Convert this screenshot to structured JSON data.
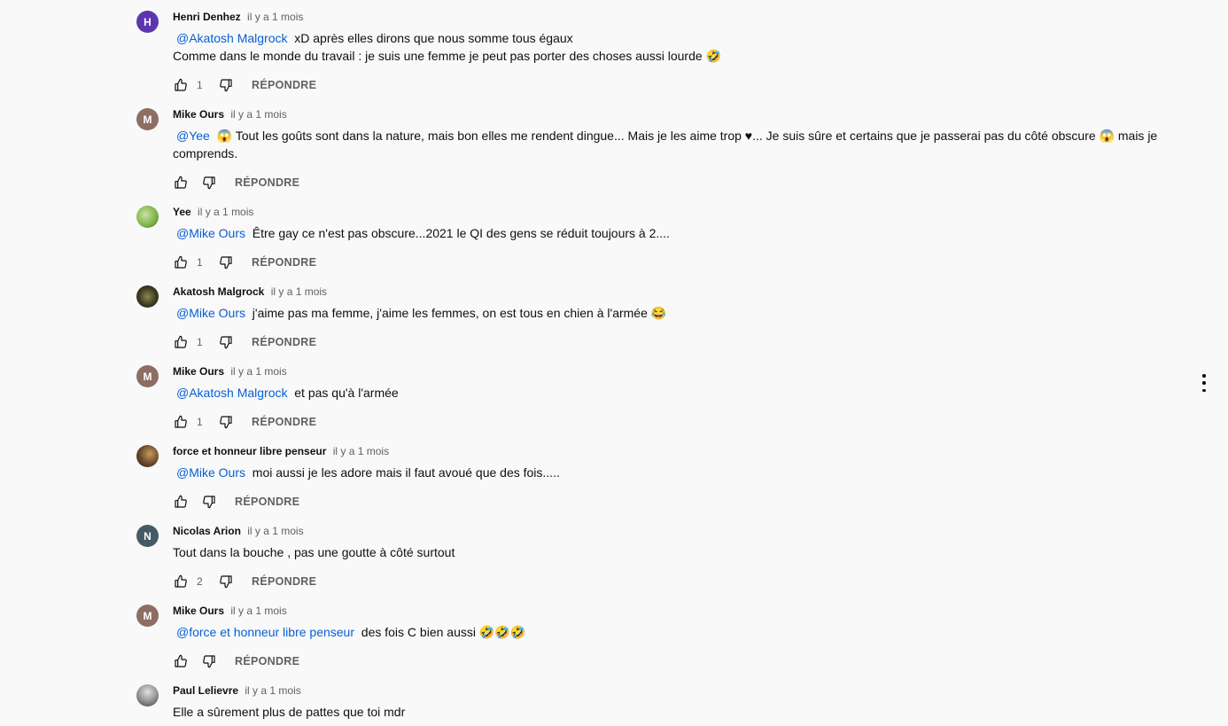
{
  "actions": {
    "reply_label": "RÉPONDRE"
  },
  "colors": {
    "link": "#065fd4",
    "meta": "#606060"
  },
  "comments": [
    {
      "author": "Henri Denhez",
      "time": "il y a 1 mois",
      "avatar": {
        "initial": "H",
        "color": "#5e35b1"
      },
      "mention": "@Akatosh Malgrock",
      "text_line1": "xD après elles dirons que nous somme tous égaux",
      "text_line2": "Comme dans le monde du travail : je suis une femme je peut pas porter des choses aussi lourde",
      "emoji": "🤣",
      "likes": "1"
    },
    {
      "author": "Mike Ours",
      "time": "il y a 1 mois",
      "avatar": {
        "initial": "M",
        "color": "#8d6e63"
      },
      "mention": "@Yee",
      "emoji1": "😱",
      "text_a": "Tout les goûts sont dans la nature, mais bon elles me rendent dingue... Mais je les aime trop ♥... Je suis sûre et certains que je passerai pas du côté obscure",
      "emoji2": "😱",
      "text_b": "mais je comprends.",
      "likes": ""
    },
    {
      "author": "Yee",
      "time": "il y a 1 mois",
      "avatar": {
        "initial": "",
        "color": "#7cb342"
      },
      "mention": "@Mike Ours",
      "text": "Être gay ce n'est pas obscure...2021 le QI des gens se réduit toujours à 2....",
      "likes": "1"
    },
    {
      "author": "Akatosh Malgrock",
      "time": "il y a 1 mois",
      "avatar": {
        "initial": "",
        "color": "#3e3a26"
      },
      "mention": "@Mike Ours",
      "text": "j'aime pas ma femme, j'aime les femmes, on est tous en chien à l'armée",
      "emoji": "😂",
      "likes": "1"
    },
    {
      "author": "Mike Ours",
      "time": "il y a 1 mois",
      "avatar": {
        "initial": "M",
        "color": "#8d6e63"
      },
      "mention": "@Akatosh Malgrock",
      "text": "et pas qu'à l'armée",
      "likes": "1"
    },
    {
      "author": "force et honneur libre penseur",
      "time": "il y a 1 mois",
      "avatar": {
        "initial": "",
        "color": "#6d4c2f"
      },
      "mention": "@Mike Ours",
      "text": "moi aussi je les adore mais il faut avoué que des fois.....",
      "likes": ""
    },
    {
      "author": "Nicolas Arion",
      "time": "il y a 1 mois",
      "avatar": {
        "initial": "N",
        "color": "#455a64"
      },
      "text": "Tout dans la bouche , pas une goutte à côté surtout",
      "likes": "2"
    },
    {
      "author": "Mike Ours",
      "time": "il y a 1 mois",
      "avatar": {
        "initial": "M",
        "color": "#8d6e63"
      },
      "mention": "@force et honneur libre penseur",
      "text": "des fois C bien aussi",
      "emoji": "🤣🤣🤣",
      "likes": ""
    },
    {
      "author": "Paul Lelievre",
      "time": "il y a 1 mois",
      "avatar": {
        "initial": "",
        "color": "#9e9e9e"
      },
      "text": "Elle a sûrement plus de pattes que toi mdr"
    }
  ]
}
